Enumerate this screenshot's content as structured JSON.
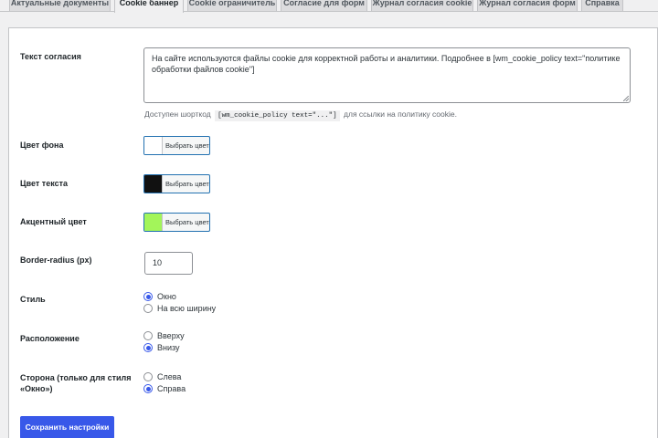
{
  "tabs": [
    {
      "label": "Актуальные документы"
    },
    {
      "label": "Cookie баннер"
    },
    {
      "label": "Cookie ограничитель"
    },
    {
      "label": "Согласие для форм"
    },
    {
      "label": "Журнал согласия cookie"
    },
    {
      "label": "Журнал согласия форм"
    },
    {
      "label": "Справка"
    }
  ],
  "active_tab": "Cookie баннер",
  "consent_text": {
    "label": "Текст согласия",
    "value": "На сайте используются файлы cookie для корректной работы и аналитики. Подробнее в [wm_cookie_policy text=\"политике обработки файлов cookie\"]",
    "hint_prefix": "Доступен шорткод",
    "hint_code": "[wm_cookie_policy text=\"...\"]",
    "hint_suffix": "для ссылки на политику cookie."
  },
  "bg_color": {
    "label": "Цвет фона",
    "button": "Выбрать цвет",
    "value": "#ffffff"
  },
  "text_color": {
    "label": "Цвет текста",
    "button": "Выбрать цвет",
    "value": "#111111"
  },
  "accent_color": {
    "label": "Акцентный цвет",
    "button": "Выбрать цвет",
    "value": "#a3f55a"
  },
  "border_radius": {
    "label": "Border-radius (px)",
    "value": "10"
  },
  "style": {
    "label": "Стиль",
    "options": [
      {
        "label": "Окно",
        "checked": true
      },
      {
        "label": "На всю ширину",
        "checked": false
      }
    ]
  },
  "position": {
    "label": "Расположение",
    "options": [
      {
        "label": "Вверху",
        "checked": false
      },
      {
        "label": "Внизу",
        "checked": true
      }
    ]
  },
  "side": {
    "label_line1": "Сторона (только для стиля",
    "label_line2": "«Окно»)",
    "options": [
      {
        "label": "Слева",
        "checked": false
      },
      {
        "label": "Справа",
        "checked": true
      }
    ]
  },
  "submit": {
    "label": "Сохранить настройки"
  },
  "colors": {
    "accent": "#3858e9",
    "border": "#c3c4c7"
  }
}
